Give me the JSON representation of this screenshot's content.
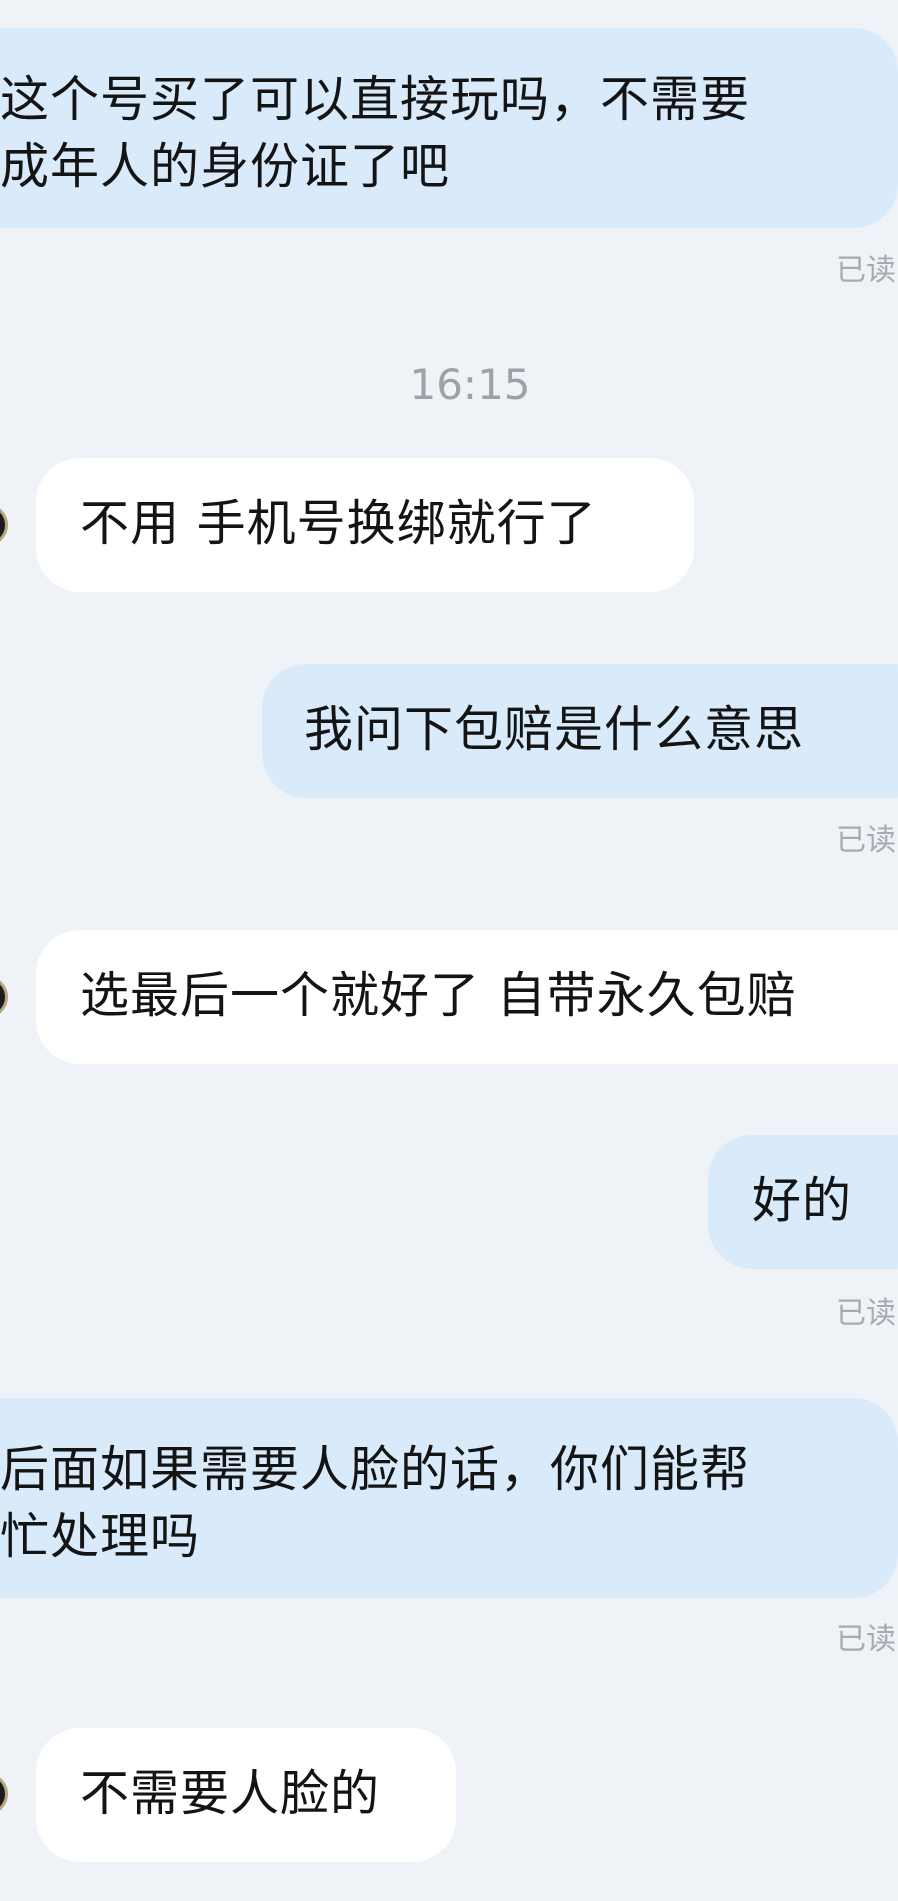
{
  "chat": {
    "timestamp": "16:15",
    "read_label": "已读",
    "messages": [
      {
        "side": "out",
        "text": "这个号买了可以直接玩吗，不需要\n成年人的身份证了吧",
        "read": "已读"
      },
      {
        "side": "in",
        "text": "不用 手机号换绑就行了"
      },
      {
        "side": "out",
        "text": "我问下包赔是什么意思",
        "read": "已读"
      },
      {
        "side": "in",
        "text": "选最后一个就好了 自带永久包赔"
      },
      {
        "side": "out",
        "text": "好的",
        "read": "已读"
      },
      {
        "side": "out",
        "text": "后面如果需要人脸的话，你们能帮\n忙处理吗",
        "read": "已读"
      },
      {
        "side": "in",
        "text": "不需要人脸的"
      }
    ]
  },
  "colors": {
    "background": "#eff3f8",
    "outgoing_bubble": "#d9eafb",
    "incoming_bubble": "#ffffff",
    "read_text": "#a6abb2",
    "timestamp_text": "#9da2a8"
  }
}
